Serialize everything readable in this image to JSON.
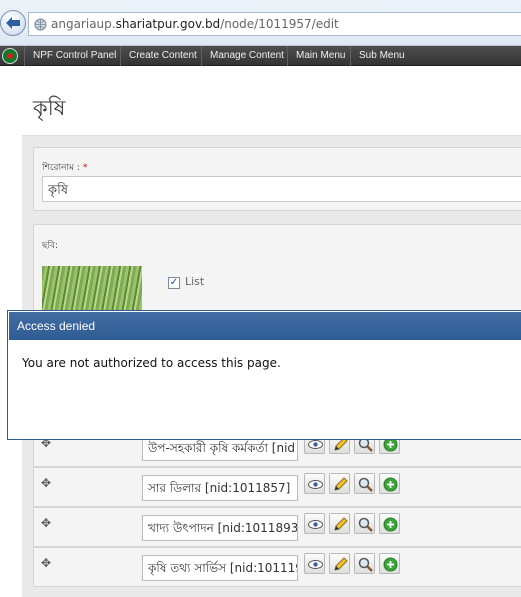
{
  "browser": {
    "url_prefix": "angariaup.",
    "url_host": "shariatpur.gov.bd",
    "url_path": "/node/1011957/edit"
  },
  "admin_menu": {
    "items": [
      {
        "label": "NPF Control Panel"
      },
      {
        "label": "Create Content"
      },
      {
        "label": "Manage Content"
      },
      {
        "label": "Main Menu"
      },
      {
        "label": "Sub Menu"
      }
    ]
  },
  "page": {
    "title": "কৃষি",
    "title_field_label": "শিরোনাম :",
    "required_marker": "*",
    "title_value": "কৃষি",
    "image_field_label": "ছবি:",
    "list_label": "List",
    "list_checkmark": "✓"
  },
  "rows": [
    {
      "value": "উপ-সহকারী কৃষি কর্মকর্তা [nid"
    },
    {
      "value": "সার ডিলার [nid:1011857]"
    },
    {
      "value": "খাদ্য উৎপাদন [nid:1011893]"
    },
    {
      "value": "কৃষি তথ্য সার্ভিস [nid:101119"
    }
  ],
  "dialog": {
    "title": "Access denied",
    "message": "You are not authorized to access this page."
  },
  "icons": {
    "back": "back-arrow-icon",
    "globe": "globe-icon",
    "drag": "move-handle-icon",
    "view": "eye-icon",
    "edit": "pencil-icon",
    "search": "magnifier-icon",
    "add": "plus-circle-icon"
  },
  "colors": {
    "dialog_title_bar": "#2f5c93",
    "admin_bar": "#3e3e3e",
    "add_icon": "#3ca53c"
  }
}
